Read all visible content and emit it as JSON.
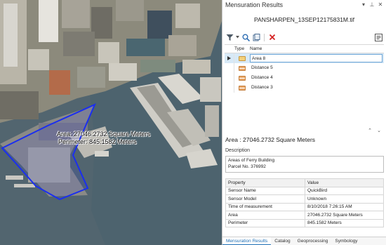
{
  "map": {
    "area_label": "Area: 27046.2732 Square Meters",
    "perimeter_label": "Perimeter: 845.1582 Meters",
    "polygon_color": "#1a2ef0"
  },
  "pane": {
    "title": "Mensuration Results",
    "file_name": "PANSHARPEN_13SEP12175831M.tif",
    "toolbar_icons": [
      "filter-icon",
      "zoom-to-icon",
      "copy-icon",
      "delete-icon",
      "options-icon"
    ],
    "grid": {
      "headers": [
        "Type",
        "Name"
      ],
      "rows": [
        {
          "name": "Area 8",
          "type_icon": "area-icon",
          "selected": true
        },
        {
          "name": "Distance 5",
          "type_icon": "distance-icon",
          "selected": false
        },
        {
          "name": "Distance 4",
          "type_icon": "distance-icon",
          "selected": false
        },
        {
          "name": "Distance 3",
          "type_icon": "distance-icon",
          "selected": false
        }
      ]
    },
    "measurement_title": "Area : 27046.2732 Square Meters",
    "description_label": "Description",
    "description_lines": [
      "Areas of Ferry Building",
      "Parcel No. 376992"
    ],
    "properties": {
      "headers": [
        "Property",
        "Value"
      ],
      "rows": [
        [
          "Sensor Name",
          "QuickBird"
        ],
        [
          "Sensor Model",
          "Unknown"
        ],
        [
          "Time of measurement",
          "8/10/2018 7:26:15 AM"
        ],
        [
          "Area",
          "27046.2732 Square Meters"
        ],
        [
          "Perimeter",
          "845.1582 Meters"
        ]
      ]
    },
    "tabs": [
      "Mensuration Results",
      "Catalog",
      "Geoprocessing",
      "Symbology"
    ],
    "active_tab": "Mensuration Results",
    "colors": {
      "accent": "#1f6fb5",
      "selection": "#d7e9f7",
      "delete": "#d42020"
    }
  }
}
